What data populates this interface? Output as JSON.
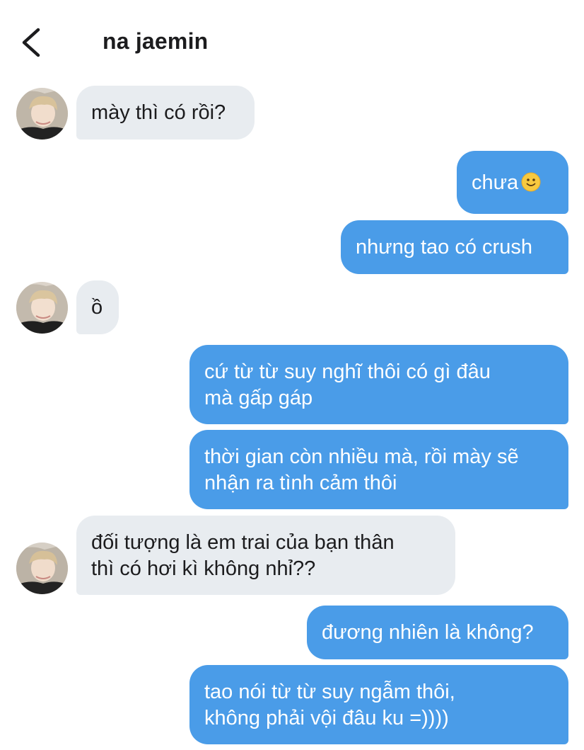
{
  "header": {
    "title": "na jaemin"
  },
  "colors": {
    "outgoing_bubble": "#4a9ce8",
    "incoming_bubble": "#e8ecf0",
    "text_dark": "#1c1c1e"
  },
  "messages": [
    {
      "direction": "in",
      "lines": [
        "mày thì có rồi?"
      ]
    },
    {
      "direction": "out",
      "lines": [
        "chưa"
      ],
      "emoji": "slightly-smiling-face-icon"
    },
    {
      "direction": "out",
      "lines": [
        "nhưng tao có crush"
      ]
    },
    {
      "direction": "in",
      "lines": [
        "ồ"
      ]
    },
    {
      "direction": "out",
      "lines": [
        "cứ từ từ suy nghĩ thôi có gì đâu",
        "mà gấp gáp"
      ]
    },
    {
      "direction": "out",
      "lines": [
        "thời gian còn nhiều mà, rồi mày sẽ",
        "nhận ra tình cảm thôi"
      ]
    },
    {
      "direction": "in",
      "lines": [
        "đối tượng là em trai của bạn thân",
        "thì có hơi kì không nhỉ??"
      ]
    },
    {
      "direction": "out",
      "lines": [
        "đương nhiên là không?"
      ]
    },
    {
      "direction": "out",
      "lines": [
        "tao nói từ từ suy ngẫm thôi,",
        "không phải vội đâu ku =))))"
      ]
    }
  ]
}
